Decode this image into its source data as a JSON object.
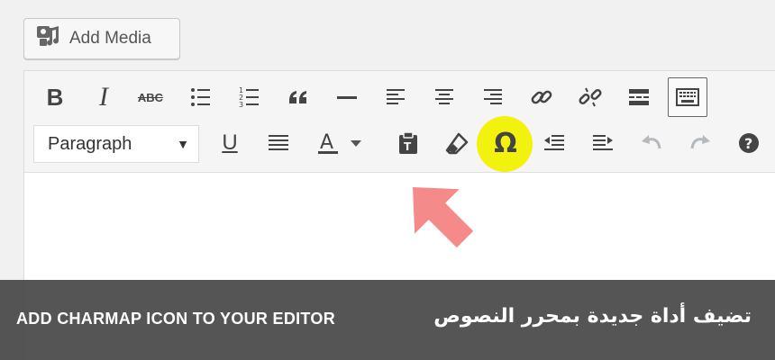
{
  "add_media": {
    "label": "Add Media",
    "icon": "media-icon"
  },
  "toolbar": {
    "row1": [
      {
        "name": "bold-button",
        "glyph": "B"
      },
      {
        "name": "italic-button",
        "glyph": "I"
      },
      {
        "name": "strikethrough-button",
        "glyph": "ABC"
      },
      {
        "name": "bullet-list-button",
        "icon": "bullet-list-icon"
      },
      {
        "name": "numbered-list-button",
        "icon": "numbered-list-icon"
      },
      {
        "name": "blockquote-button",
        "icon": "quote-icon"
      },
      {
        "name": "horizontal-line-button",
        "icon": "horizontal-line-icon"
      },
      {
        "name": "align-left-button",
        "icon": "align-left-icon"
      },
      {
        "name": "align-center-button",
        "icon": "align-center-icon"
      },
      {
        "name": "align-right-button",
        "icon": "align-right-icon"
      },
      {
        "name": "insert-link-button",
        "icon": "link-icon"
      },
      {
        "name": "remove-link-button",
        "icon": "unlink-icon"
      },
      {
        "name": "read-more-button",
        "icon": "read-more-icon"
      },
      {
        "name": "toolbar-toggle-button",
        "icon": "keyboard-icon",
        "active": true
      }
    ],
    "row2": {
      "format_select": {
        "value": "Paragraph"
      },
      "underline_glyph": "U",
      "text_color_glyph": "A",
      "special_char_glyph": "Ω"
    },
    "highlight_color": "#f2f20c",
    "arrow_color": "#f48a8a"
  },
  "banner": {
    "left_text": "ADD CHARMAP ICON TO YOUR EDITOR",
    "right_text": "تضيف أداة جديدة بمحرر النصوص"
  }
}
